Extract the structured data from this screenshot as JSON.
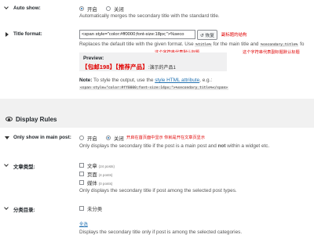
{
  "auto_show": {
    "label": "Auto show:",
    "on_label": "开启",
    "off_label": "关闭",
    "help": "Automatically merges the secondary title with the standard title."
  },
  "title_format": {
    "label": "Title format:",
    "input_value": "<span style=\"color:#ff0000;font-size:18px;\">%seco",
    "restore_label": "恢复",
    "annotation_right": "副标题的结构",
    "help_prefix": "Replaces the default title with the given format. Use",
    "code_title": "%title%",
    "help_middle": "for the main title and",
    "code_secondary": "%secondary_title%",
    "help_suffix": "fo",
    "annotation_left": "这个字符串代表默认标题",
    "annotation_right2": "这个字符串代表副标题默认标题",
    "preview_label": "Preview:",
    "preview_red": "【包邮198】【推荐产品】",
    "preview_plain": ":演示的产品1",
    "note_bold": "Note:",
    "note_text": "To style the output, use the",
    "note_link": "style HTML attribute",
    "note_suffix": ", e.g.:",
    "note_code": "<span style=\"color:#ff0000;font-size:14px;\">%secondary_title%</span>"
  },
  "display_rules": {
    "heading": "Display Rules",
    "icon": "eye-icon"
  },
  "only_main_post": {
    "label": "Only show in main post:",
    "on_label": "开启",
    "off_label": "关闭",
    "annotation": "开启在首页面中显示 你就是开在文章页显示",
    "help_prefix": "Only displays the secondary title if the post is a main post and",
    "help_bold": "not",
    "help_suffix": "within a widget etc."
  },
  "post_types": {
    "label": "文章类型:",
    "items": [
      {
        "name": "文章",
        "count": "(24 posts)"
      },
      {
        "name": "页面",
        "count": "(4 posts)"
      },
      {
        "name": "媒体",
        "count": "(0 posts)"
      }
    ],
    "help": "Only displays the secondary title if post among the selected post types."
  },
  "categories": {
    "label": "分类目录:",
    "items": [
      {
        "name": "未分类"
      }
    ],
    "select_all": "全选",
    "help": "Displays the secondary title only if post is among the selected categories."
  }
}
